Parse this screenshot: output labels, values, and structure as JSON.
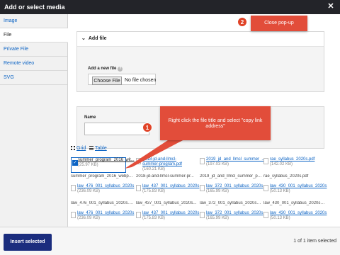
{
  "dialog": {
    "title": "Add or select media"
  },
  "sidebar": {
    "items": [
      {
        "label": "Image"
      },
      {
        "label": "File"
      },
      {
        "label": "Private File"
      },
      {
        "label": "Remote video"
      },
      {
        "label": "SVG"
      }
    ]
  },
  "add_file": {
    "summary": "Add file",
    "field_label": "Add a new file",
    "button_label": "Choose File",
    "status": "No file chosen"
  },
  "filters": {
    "name_label": "Name",
    "second_label": "So"
  },
  "view": {
    "grid_label": "Grid",
    "table_label": "Table"
  },
  "media": [
    {
      "name": "summer_program_2016_wit...",
      "size": "(25.97 KB)",
      "caption": "summer_program_2016_webpa..."
    },
    {
      "name": "2018-jd-and-llmcl-summer-program.pdf",
      "size": "(160.21 KB)",
      "caption": "2018-jd-and-llmcl-summer-pr..."
    },
    {
      "name": "2019_jd_and_llmcl_summer_...",
      "size": "(197.03 KB)",
      "caption": "2019_jd_and_llmcl_summer_pr..."
    },
    {
      "name": "rae_syllabus_2020s.pdf",
      "size": "(142.02 KB)",
      "caption": "rae_syllabus_2020s.pdf"
    },
    {
      "name": "law_476_001_syllabus_2020s",
      "size": "(236.09 KB)",
      "caption": "law_476_001_syllabus_2020s.pdf"
    },
    {
      "name": "law_437_001_syllabus_2020s",
      "size": "(175.83 KB)",
      "caption": "law_437_001_syllabus_2020s..."
    },
    {
      "name": "law_372_001_syllabus_2020s",
      "size": "(165.99 KB)",
      "caption": "law_372_001_syllabus_2020s.pdf"
    },
    {
      "name": "law_430_001_syllabus_2020s",
      "size": "(50.13 KB)",
      "caption": "law_430_001_syllabus_2020s.pdf"
    },
    {
      "name": "law_476_001_syllabus_2020s",
      "size": "(236.09 KB)",
      "caption": ""
    },
    {
      "name": "law_437_001_syllabus_2020s",
      "size": "(175.83 KB)",
      "caption": ""
    },
    {
      "name": "law_372_001_syllabus_2020s",
      "size": "(165.99 KB)",
      "caption": ""
    },
    {
      "name": "law_430_001_syllabus_2020s",
      "size": "(50.13 KB)",
      "caption": ""
    }
  ],
  "footer": {
    "insert_label": "Insert selected",
    "selected_count": "1 of 1 item selected"
  },
  "annotations": {
    "step1_number": "1",
    "step1_text": "Right click the file title and select \"copy link address\"",
    "step2_number": "2",
    "step2_text": "Close pop-up"
  },
  "colors": {
    "titlebar": "#232429",
    "link": "#0b63c4",
    "primary_button": "#1b2d7e",
    "callout": "#e24d3a"
  }
}
